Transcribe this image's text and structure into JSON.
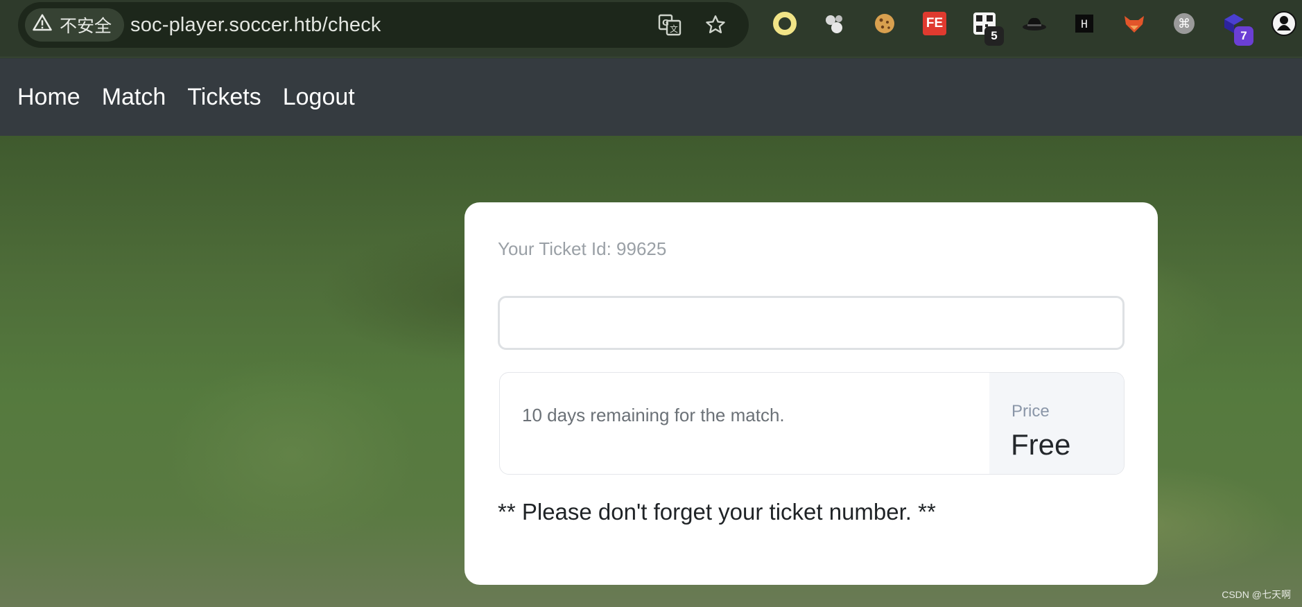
{
  "browser": {
    "security_label": "不安全",
    "url": "soc-player.soccer.htb/check",
    "extensions": [
      {
        "name": "circle-extension-icon",
        "badge": ""
      },
      {
        "name": "bubbles-extension-icon",
        "badge": ""
      },
      {
        "name": "cookie-extension-icon",
        "badge": ""
      },
      {
        "name": "fe-extension-icon",
        "badge": ""
      },
      {
        "name": "qr-extension-icon",
        "badge": "5"
      },
      {
        "name": "hat-extension-icon",
        "badge": ""
      },
      {
        "name": "h-extension-icon",
        "badge": ""
      },
      {
        "name": "fox-extension-icon",
        "badge": ""
      },
      {
        "name": "command-extension-icon",
        "badge": ""
      },
      {
        "name": "cube-extension-icon",
        "badge": "7"
      },
      {
        "name": "profile-avatar-icon",
        "badge": ""
      }
    ],
    "fe_text": "FE",
    "h_text": "H",
    "cmd_text": "⌘"
  },
  "nav": {
    "home": "Home",
    "match": "Match",
    "tickets": "Tickets",
    "logout": "Logout"
  },
  "ticket": {
    "id_label": "Your Ticket Id: 99625",
    "input_value": "",
    "remaining": "10 days remaining for the match.",
    "price_label": "Price",
    "price_value": "Free",
    "note": "** Please don't forget your ticket number. **"
  },
  "watermark": "CSDN @七天啊",
  "colors": {
    "navbar": "#353b40",
    "card": "#ffffff",
    "badge_dark": "#222222",
    "badge_purple": "#6b3fd4"
  }
}
